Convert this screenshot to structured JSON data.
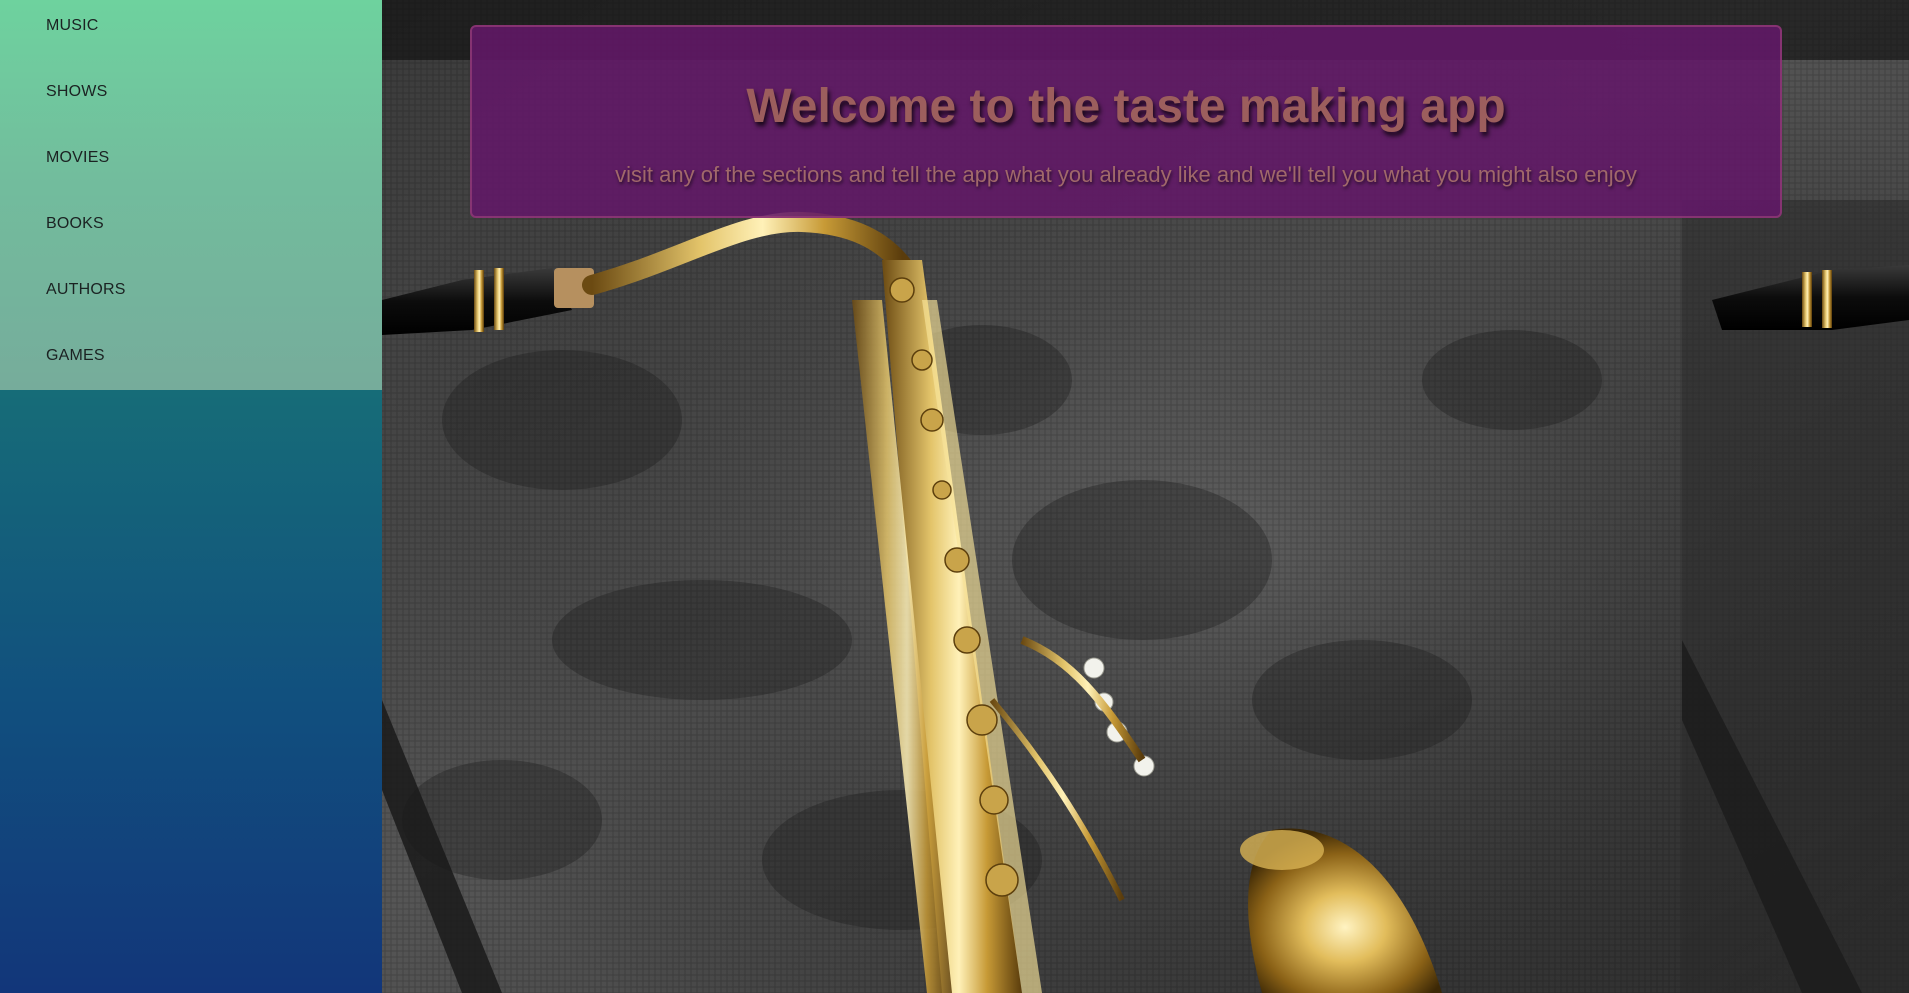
{
  "sidebar": {
    "items": [
      {
        "label": "MUSIC"
      },
      {
        "label": "SHOWS"
      },
      {
        "label": "MOVIES"
      },
      {
        "label": "BOOKS"
      },
      {
        "label": "AUTHORS"
      },
      {
        "label": "GAMES"
      }
    ]
  },
  "welcome": {
    "title": "Welcome to the taste making app",
    "subtitle": "visit any of the sections and tell the app what you already like and we'll tell you what you might also enjoy"
  },
  "background": {
    "subject": "saxophone-photo"
  },
  "colors": {
    "sidebar_menu_top": "#6ed29e",
    "sidebar_menu_bottom": "#76ac9b",
    "sidebar_gradient_top": "#1e8f86",
    "sidebar_gradient_bottom": "#12367a",
    "banner_bg": "#621868",
    "banner_text": "#9c5e5d"
  }
}
